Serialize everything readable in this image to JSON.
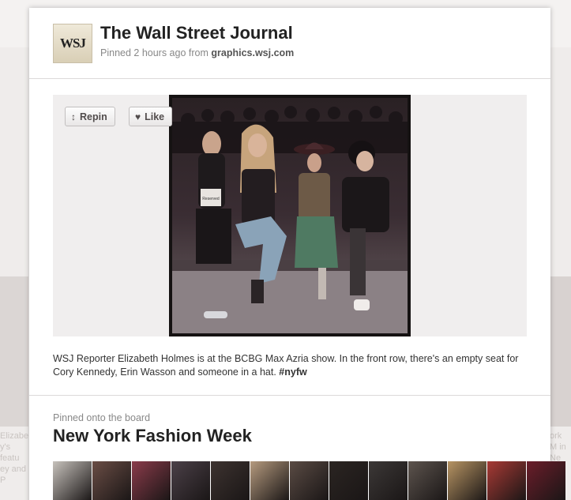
{
  "pin": {
    "logo_text": "WSJ",
    "pinner_name": "The Wall Street Journal",
    "pinned_prefix": "Pinned 2 hours ago from ",
    "source_domain": "graphics.wsj.com",
    "description_text": "WSJ Reporter Elizabeth Holmes is at the BCBG Max Azria show. In the front row, there's an empty seat for Cory Kennedy, Erin Wasson and someone in a hat. ",
    "hashtag": "#nyfw",
    "placard_text": "Reserved"
  },
  "actions": {
    "repin_label": "Repin",
    "like_label": "Like"
  },
  "board": {
    "kicker": "Pinned onto the board",
    "name": "New York Fashion Week",
    "thumb_colors": [
      "#c7c2bc",
      "#6a4d45",
      "#8a3b4a",
      "#4b4048",
      "#3d3330",
      "#b59a7e",
      "#5a4b44",
      "#2b2522",
      "#3c3837",
      "#5d544e",
      "#b79463",
      "#a83a35",
      "#6b1d2a"
    ]
  },
  "background": {
    "left_text": "Elizabeth y's featu ey and P",
    "right_text": "ork M in Ne"
  },
  "colors": {
    "card_bg": "#ffffff",
    "page_bg": "#e9e6e4",
    "title": "#222222",
    "meta": "#888888"
  }
}
